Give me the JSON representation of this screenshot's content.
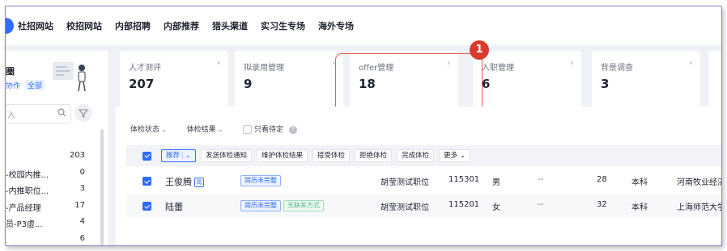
{
  "topnav": {
    "items": [
      "社招网站",
      "校招网站",
      "内部招聘",
      "内部推荐",
      "猎头渠道",
      "实习生专场",
      "海外专场"
    ]
  },
  "sidebar": {
    "title": "圈",
    "tabs": [
      "协作",
      "全部"
    ],
    "search_placeholder": "入",
    "items": [
      {
        "label": "",
        "count": "203"
      },
      {
        "label": "-校园内推...",
        "count": "0"
      },
      {
        "label": "-内推职位...",
        "count": "3"
      },
      {
        "label": "-产品经理",
        "count": "17"
      },
      {
        "label": "员-P3虚...",
        "count": "4"
      },
      {
        "label": "",
        "count": "6"
      }
    ]
  },
  "cards": [
    {
      "label": "人才测评",
      "value": "207"
    },
    {
      "label": "拟录用管理",
      "value": "9"
    },
    {
      "label": "offer管理",
      "value": "18"
    },
    {
      "label": "入职管理",
      "value": "6"
    },
    {
      "label": "背景调查",
      "value": "3"
    }
  ],
  "annotation": {
    "number": "1",
    "color": "#d93c2f"
  },
  "filters": {
    "status": "体检状态",
    "result": "体检结果",
    "pending_only": "只看待定"
  },
  "toolbar": {
    "recommend": "推荐",
    "actions": [
      "发送体检通知",
      "维护体检结果",
      "接受体检",
      "拒绝体检",
      "完成体检",
      "更多"
    ]
  },
  "rows": [
    {
      "name": "王俊腾",
      "resume_icon": "简",
      "tags": [
        "简历未完整"
      ],
      "position": "胡莹测试职位",
      "id": "115301",
      "gender": "男",
      "dash": "--",
      "age": "28",
      "degree": "本科",
      "school": "河南牧业经济学"
    },
    {
      "name": "陆蕾",
      "tags": [
        "简历未完整",
        "无联系方式"
      ],
      "position": "胡莹测试职位",
      "id": "115201",
      "gender": "女",
      "dash": "--",
      "age": "32",
      "degree": "本科",
      "school": "上海师范大学天"
    }
  ],
  "colors": {
    "accent": "#2f6bff",
    "highlight": "#e15a52"
  }
}
